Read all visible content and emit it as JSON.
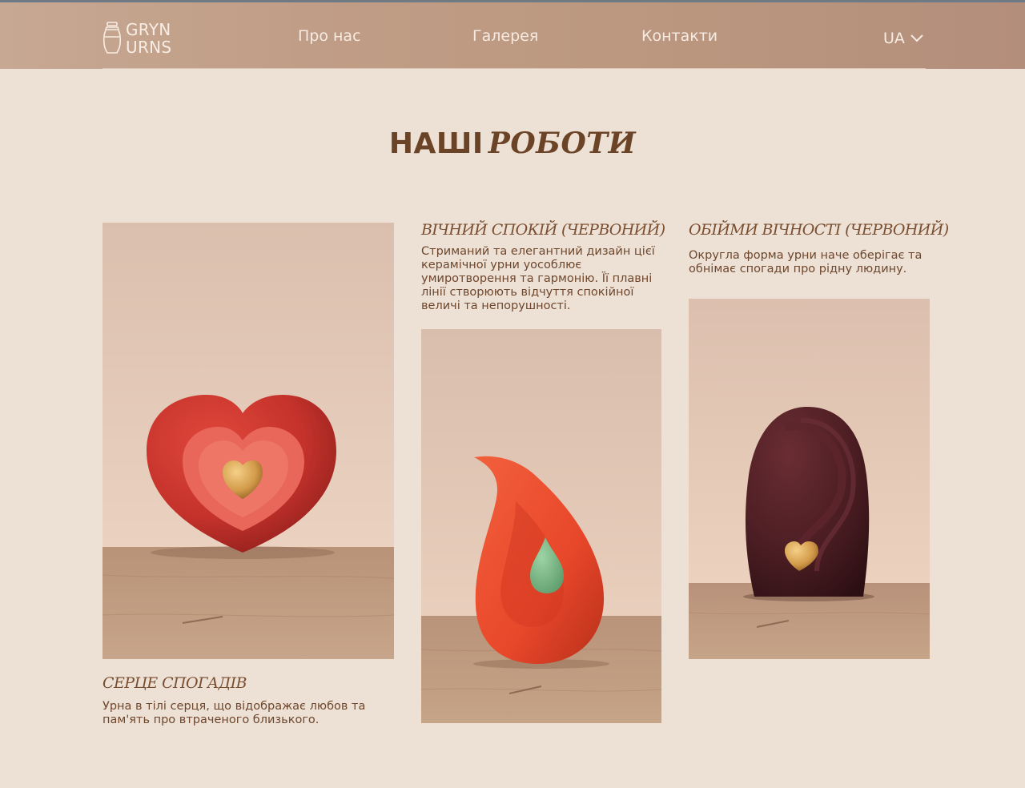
{
  "header": {
    "logo": {
      "line1": "GRYN",
      "line2": "URNS"
    },
    "nav": [
      {
        "label": "Про нас"
      },
      {
        "label": "Галерея"
      },
      {
        "label": "Контакти"
      }
    ],
    "language": "UA"
  },
  "section": {
    "title_plain": "НАШІ",
    "title_italic": "РОБОТИ"
  },
  "works": [
    {
      "title": "СЕРЦЕ СПОГАДІВ",
      "description": "Урна в тілі серця, що відображає любов та пам'ять про втраченого близького."
    },
    {
      "title": "ВІЧНИЙ СПОКІЙ (ЧЕРВОНИЙ)",
      "description": "Стриманий та елегантний дизайн цієї керамічної урни уособлює умиротворення та гармонію. Її плавні лінії створюють відчуття спокійної величі та непорушності."
    },
    {
      "title": "ОБІЙМИ ВІЧНОСТІ (ЧЕРВОНИЙ)",
      "description": "Округла форма урни наче оберігає та обнімає спогади про рідну людину."
    }
  ],
  "colors": {
    "background": "#ede0d4",
    "header": "#bc9880",
    "text_brown": "#6b4427",
    "heart_urn": "#c4322b",
    "drop_urn": "#e8472a",
    "oval_urn": "#4a1d22",
    "gold_heart": "#d39b4a",
    "green_drop": "#6fae7c"
  }
}
